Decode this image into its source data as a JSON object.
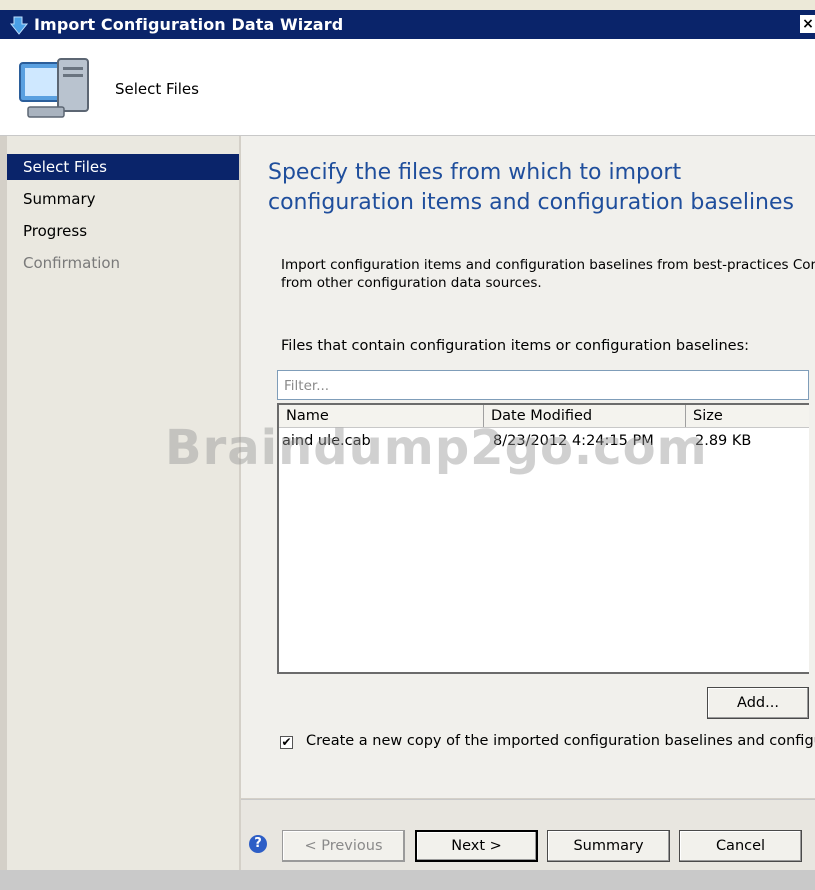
{
  "window": {
    "title": "Import Configuration Data Wizard",
    "close_glyph": "×"
  },
  "header": {
    "page_title": "Select Files",
    "icon": "computer-icon"
  },
  "sidebar": {
    "items": [
      {
        "label": "Select Files",
        "state": "selected"
      },
      {
        "label": "Summary",
        "state": "normal"
      },
      {
        "label": "Progress",
        "state": "normal"
      },
      {
        "label": "Confirmation",
        "state": "disabled"
      }
    ]
  },
  "main": {
    "heading": "Specify the files from which to import configuration items and configuration baselines",
    "description_line1": "Import configuration items and configuration baselines from best-practices Cor",
    "description_line2": "from other configuration data sources.",
    "list_label": "Files that contain configuration items or configuration baselines:",
    "filter_placeholder": "Filter...",
    "columns": [
      "Name",
      "Date Modified",
      "Size"
    ],
    "rows": [
      {
        "name": "aind ule.cab",
        "date": "8/23/2012 4:24:15 PM",
        "size": "2.89 KB"
      }
    ],
    "add_button": "Add...",
    "checkbox_checked": true,
    "checkbox_mark": "✔",
    "checkbox_label": "Create a new copy of the imported configuration baselines and configurati"
  },
  "footer": {
    "help_glyph": "?",
    "previous": "< Previous",
    "next": "Next >",
    "summary": "Summary",
    "cancel": "Cancel"
  },
  "watermark": "Braindump2go.com",
  "colors": {
    "titlebar": "#0a246a",
    "heading": "#1f4e9c",
    "selected": "#0a246a"
  }
}
